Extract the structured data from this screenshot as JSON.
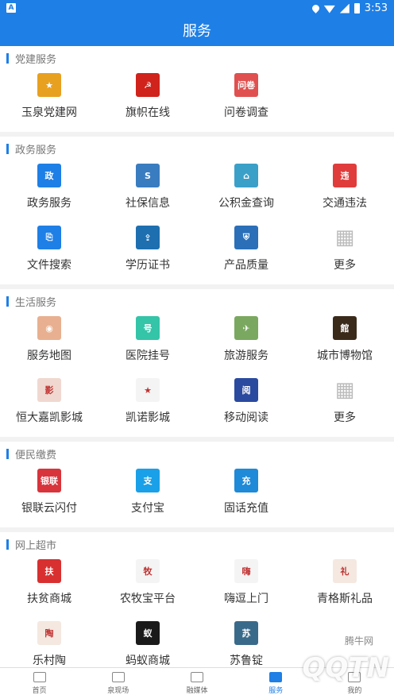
{
  "status_bar": {
    "left_badge": "A",
    "time": "3:53"
  },
  "title": "服务",
  "sections": [
    {
      "title": "党建服务",
      "items": [
        {
          "label": "玉泉党建网",
          "icon": "party-emblem-icon",
          "color": "#e8a020",
          "glyph": "★"
        },
        {
          "label": "旗帜在线",
          "icon": "flag-icon",
          "color": "#d0231b",
          "glyph": "☭"
        },
        {
          "label": "问卷调查",
          "icon": "survey-icon",
          "color": "#e05050",
          "glyph": "问卷"
        }
      ]
    },
    {
      "title": "政务服务",
      "items": [
        {
          "label": "政务服务",
          "icon": "government-service-icon",
          "color": "#1e7fe6",
          "glyph": "政"
        },
        {
          "label": "社保信息",
          "icon": "social-security-icon",
          "color": "#3a7cc0",
          "glyph": "S"
        },
        {
          "label": "公积金查询",
          "icon": "housing-fund-icon",
          "color": "#3aa0c8",
          "glyph": "⌂"
        },
        {
          "label": "交通违法",
          "icon": "traffic-violation-icon",
          "color": "#e03c3c",
          "glyph": "违"
        },
        {
          "label": "文件搜索",
          "icon": "file-search-icon",
          "color": "#1e7fe6",
          "glyph": "⎘"
        },
        {
          "label": "学历证书",
          "icon": "certificate-icon",
          "color": "#1e6fb0",
          "glyph": "⇪"
        },
        {
          "label": "产品质量",
          "icon": "product-quality-icon",
          "color": "#2a6fb8",
          "glyph": "⛨"
        },
        {
          "label": "更多",
          "icon": "more-grid-icon",
          "color": "#c8c8c8",
          "glyph": "▦"
        }
      ]
    },
    {
      "title": "生活服务",
      "items": [
        {
          "label": "服务地图",
          "icon": "map-icon",
          "color": "#e8b090",
          "glyph": "◉"
        },
        {
          "label": "医院挂号",
          "icon": "hospital-icon",
          "color": "#34c4a8",
          "glyph": "号"
        },
        {
          "label": "旅游服务",
          "icon": "travel-icon",
          "color": "#7aa860",
          "glyph": "✈"
        },
        {
          "label": "城市博物馆",
          "icon": "museum-icon",
          "color": "#3a2a1a",
          "glyph": "館"
        },
        {
          "label": "恒大嘉凯影城",
          "icon": "cinema-icon",
          "color": "#f0d8d0",
          "glyph": "影"
        },
        {
          "label": "凯诺影城",
          "icon": "cinema-star-icon",
          "color": "#f4f4f4",
          "glyph": "★"
        },
        {
          "label": "移动阅读",
          "icon": "reading-icon",
          "color": "#2a4aa0",
          "glyph": "阅"
        },
        {
          "label": "更多",
          "icon": "more-grid-icon",
          "color": "#c8c8c8",
          "glyph": "▦"
        }
      ]
    },
    {
      "title": "便民缴费",
      "items": [
        {
          "label": "银联云闪付",
          "icon": "unionpay-icon",
          "color": "#d8343c",
          "glyph": "银联"
        },
        {
          "label": "支付宝",
          "icon": "alipay-icon",
          "color": "#1aa0e8",
          "glyph": "支"
        },
        {
          "label": "固话充值",
          "icon": "phone-recharge-icon",
          "color": "#1e8ad8",
          "glyph": "充"
        }
      ]
    },
    {
      "title": "网上超市",
      "items": [
        {
          "label": "扶贫商城",
          "icon": "poverty-mall-icon",
          "color": "#d83030",
          "glyph": "扶"
        },
        {
          "label": "农牧宝平台",
          "icon": "agriculture-icon",
          "color": "#f4f4f4",
          "glyph": "牧"
        },
        {
          "label": "嗨逗上门",
          "icon": "delivery-icon",
          "color": "#f4f4f4",
          "glyph": "嗨"
        },
        {
          "label": "青格斯礼品",
          "icon": "gift-icon",
          "color": "#f4e8e0",
          "glyph": "礼"
        },
        {
          "label": "乐村陶",
          "icon": "pottery-icon",
          "color": "#f4e8e0",
          "glyph": "陶"
        },
        {
          "label": "蚂蚁商城",
          "icon": "ant-mall-icon",
          "color": "#1a1a1a",
          "glyph": "蚁"
        },
        {
          "label": "苏鲁锭",
          "icon": "suluding-icon",
          "color": "#3a6a8a",
          "glyph": "苏"
        }
      ]
    }
  ],
  "tabs": [
    {
      "label": "首页",
      "icon": "home-news-icon",
      "active": false
    },
    {
      "label": "泉现场",
      "icon": "video-icon",
      "active": false
    },
    {
      "label": "融媒体",
      "icon": "media-icon",
      "active": false
    },
    {
      "label": "服务",
      "icon": "service-icon",
      "active": true
    },
    {
      "label": "我的",
      "icon": "profile-icon",
      "active": false
    }
  ],
  "watermark": {
    "main": "QQTN",
    "sub": "腾牛网"
  }
}
